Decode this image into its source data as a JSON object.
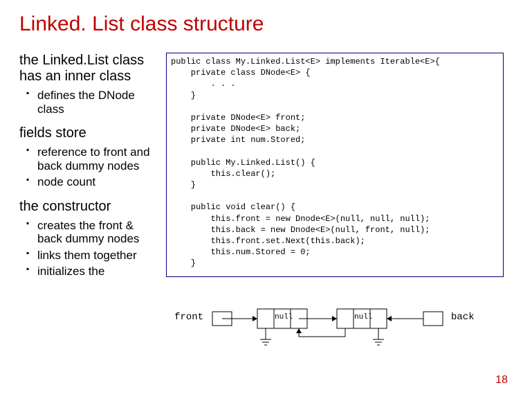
{
  "title": "Linked. List class structure",
  "left": {
    "sub1": "the Linked.List class has an inner class",
    "bullets1": [
      "defines the DNode class"
    ],
    "sub2": "fields store",
    "bullets2": [
      "reference to front and back dummy nodes",
      "node count"
    ],
    "sub3": "the constructor",
    "bullets3": [
      "creates the front & back dummy nodes",
      "links them together",
      "initializes the"
    ]
  },
  "code": "public class My.Linked.List<E> implements Iterable<E>{\n    private class DNode<E> {\n        . . .\n    }\n\n    private DNode<E> front;\n    private DNode<E> back;\n    private int num.Stored;\n\n    public My.Linked.List() {\n        this.clear();\n    }\n\n    public void clear() {\n        this.front = new Dnode<E>(null, null, null);\n        this.back = new Dnode<E>(null, front, null);\n        this.front.set.Next(this.back);\n        this.num.Stored = 0;\n    }",
  "diagram": {
    "front": "front",
    "null1": "null",
    "null2": "null",
    "back": "back"
  },
  "page": "18"
}
